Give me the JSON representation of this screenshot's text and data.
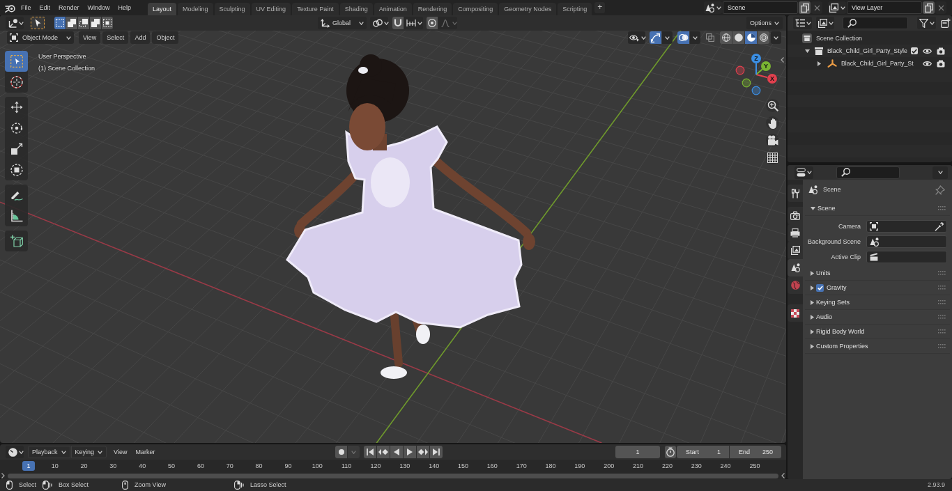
{
  "top_bar": {
    "menus": [
      "File",
      "Edit",
      "Render",
      "Window",
      "Help"
    ],
    "workspaces": [
      {
        "label": "Layout",
        "selected": true
      },
      {
        "label": "Modeling",
        "selected": false
      },
      {
        "label": "Sculpting",
        "selected": false
      },
      {
        "label": "UV Editing",
        "selected": false
      },
      {
        "label": "Texture Paint",
        "selected": false
      },
      {
        "label": "Shading",
        "selected": false
      },
      {
        "label": "Animation",
        "selected": false
      },
      {
        "label": "Rendering",
        "selected": false
      },
      {
        "label": "Compositing",
        "selected": false
      },
      {
        "label": "Geometry Nodes",
        "selected": false
      },
      {
        "label": "Scripting",
        "selected": false
      }
    ],
    "add_workspace": "+",
    "scene": "Scene",
    "view_layer": "View Layer"
  },
  "viewport": {
    "tool_header": {
      "select_modes": [
        {
          "selected": true
        },
        {
          "selected": false
        },
        {
          "selected": false
        },
        {
          "selected": false
        },
        {
          "selected": false
        }
      ],
      "orientation": "Global",
      "snap": false,
      "proportional_editing": false,
      "options": "Options"
    },
    "header": {
      "mode": "Object Mode",
      "menus": [
        "View",
        "Select",
        "Add",
        "Object"
      ],
      "gizmos": true,
      "overlays": true,
      "xray": false,
      "shading": [
        {
          "selected": false
        },
        {
          "selected": false
        },
        {
          "selected": true
        },
        {
          "selected": false
        }
      ]
    },
    "view_name": "User Perspective",
    "collection_label": "(1) Scene Collection",
    "tool_groups": [
      {
        "tools": [
          {
            "selected": true
          },
          {
            "selected": false
          }
        ]
      },
      {
        "tools": [
          {
            "selected": false
          },
          {
            "selected": false
          },
          {
            "selected": false
          },
          {
            "selected": false
          }
        ]
      },
      {
        "tools": [
          {
            "selected": false
          },
          {
            "selected": false
          }
        ]
      },
      {
        "tools": [
          {
            "selected": false
          }
        ]
      }
    ],
    "gizmo": {
      "axes": [
        {
          "label": "X",
          "color": "#e2404e"
        },
        {
          "label": "Y",
          "color": "#7ab532"
        },
        {
          "label": "Z",
          "color": "#3b8fe5"
        }
      ]
    }
  },
  "timeline": {
    "dropdowns": [
      "Playback",
      "Keying"
    ],
    "menus": [
      "View",
      "Marker"
    ],
    "auto_keying": false,
    "current_frame": "1",
    "start": {
      "label": "Start",
      "value": "1"
    },
    "end": {
      "label": "End",
      "value": "250"
    },
    "ruler": {
      "current": "1",
      "ticks": [
        "10",
        "20",
        "30",
        "40",
        "50",
        "60",
        "70",
        "80",
        "90",
        "100",
        "110",
        "120",
        "130",
        "140",
        "150",
        "160",
        "170",
        "180",
        "190",
        "200",
        "210",
        "220",
        "230",
        "240",
        "250"
      ]
    }
  },
  "outliner": {
    "tree": [
      {
        "label": "Scene Collection",
        "kind": "scene_collection",
        "children": [
          {
            "label": "Black_Child_Girl_Party_Style",
            "kind": "collection",
            "expanded": true,
            "checked": true,
            "visible": true,
            "children": [
              {
                "label": "Black_Child_Girl_Party_St",
                "kind": "armature",
                "expanded": false,
                "visible": true
              }
            ]
          }
        ]
      }
    ]
  },
  "properties": {
    "tab_groups": [
      {
        "tabs": [
          {
            "selected": false
          }
        ]
      },
      {
        "tabs": [
          {
            "selected": false
          },
          {
            "selected": false
          },
          {
            "selected": false
          },
          {
            "selected": true
          },
          {
            "selected": false
          }
        ]
      },
      {
        "tabs": [
          {
            "selected": false
          }
        ]
      }
    ],
    "title": "Scene",
    "panels": [
      {
        "title": "Scene",
        "expanded": true,
        "fields": [
          {
            "label": "Camera",
            "kind": "object"
          },
          {
            "label": "Background Scene",
            "kind": "scene"
          },
          {
            "label": "Active Clip",
            "kind": "clip"
          }
        ]
      },
      {
        "title": "Units",
        "expanded": false
      },
      {
        "title": "Gravity",
        "expanded": false,
        "checked": true
      },
      {
        "title": "Keying Sets",
        "expanded": false
      },
      {
        "title": "Audio",
        "expanded": false
      },
      {
        "title": "Rigid Body World",
        "expanded": false
      },
      {
        "title": "Custom Properties",
        "expanded": false
      }
    ]
  },
  "status_bar": {
    "hints": [
      "Select",
      "Box Select",
      "Zoom View",
      "Lasso Select"
    ],
    "version": "2.93.9"
  }
}
